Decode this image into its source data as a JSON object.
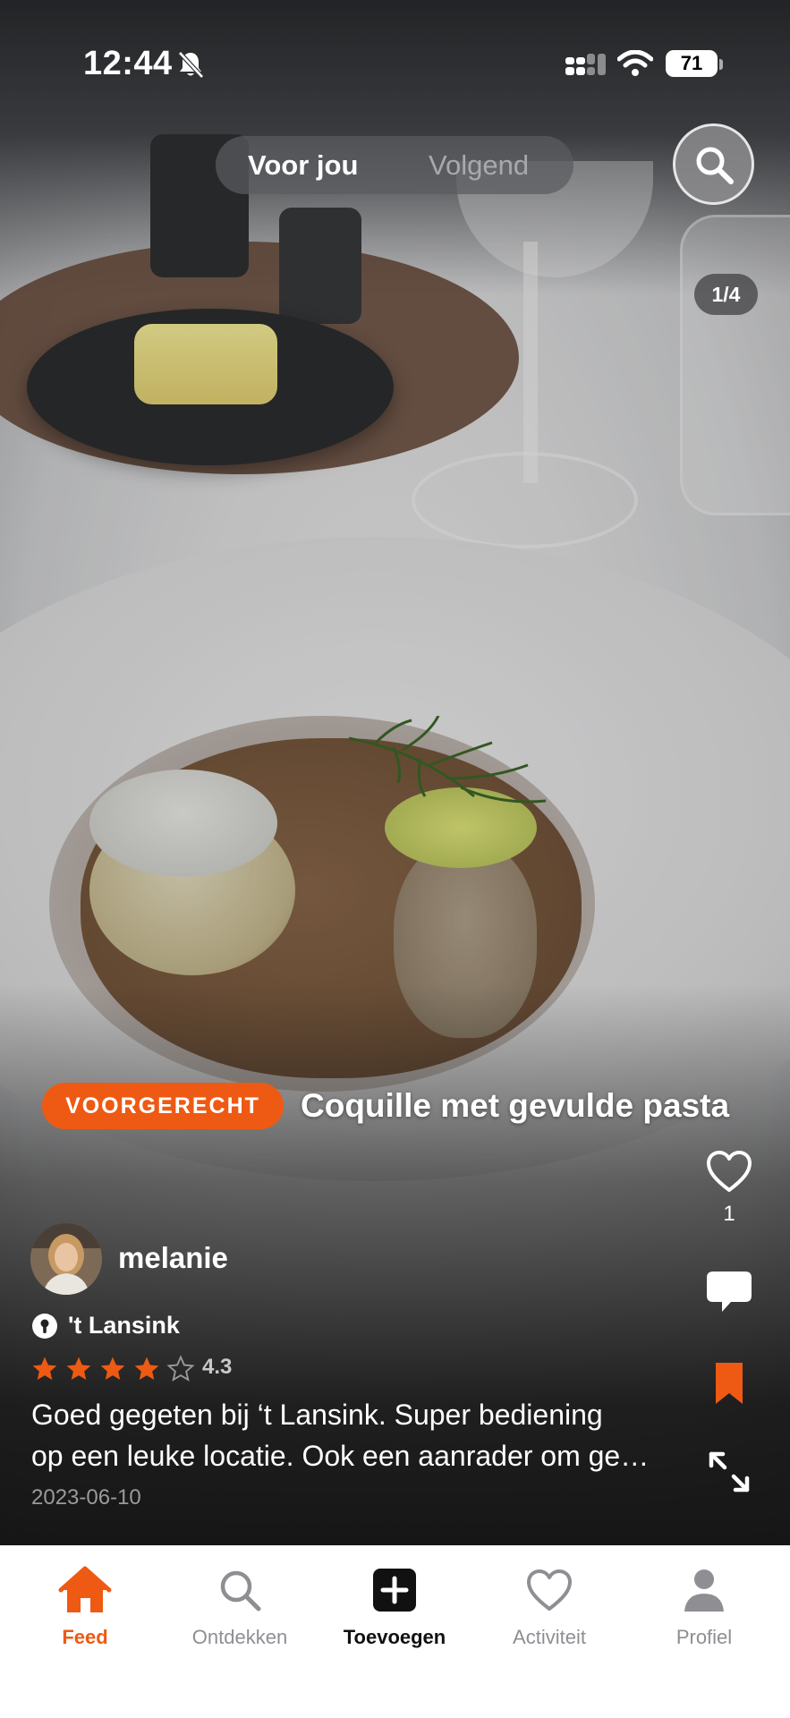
{
  "status_bar": {
    "time": "12:44",
    "battery": "71"
  },
  "feed_toggle": {
    "active_label": "Voor jou",
    "inactive_label": "Volgend"
  },
  "media": {
    "counter": "1/4"
  },
  "post": {
    "category": "VOORGERECHT",
    "title": "Coquille met gevulde pasta",
    "username": "melanie",
    "restaurant": "'t Lansink",
    "rating_value": 4.3,
    "rating_text": "4.3",
    "review_line1": "Goed gegeten bij ‘t Lansink. Super bediening",
    "review_line2": "op een leuke locatie. Ook een aanrader om ge…",
    "date": "2023-06-10",
    "likes": "1"
  },
  "nav": {
    "items": [
      {
        "label": "Feed",
        "icon": "home-icon",
        "active": true
      },
      {
        "label": "Ontdekken",
        "icon": "search-icon"
      },
      {
        "label": "Toevoegen",
        "icon": "add-icon"
      },
      {
        "label": "Activiteit",
        "icon": "heart-icon"
      },
      {
        "label": "Profiel",
        "icon": "person-icon"
      }
    ]
  },
  "colors": {
    "accent": "#EE5A13",
    "nav_inactive": "#8E8E93",
    "nav_add": "#111111"
  }
}
